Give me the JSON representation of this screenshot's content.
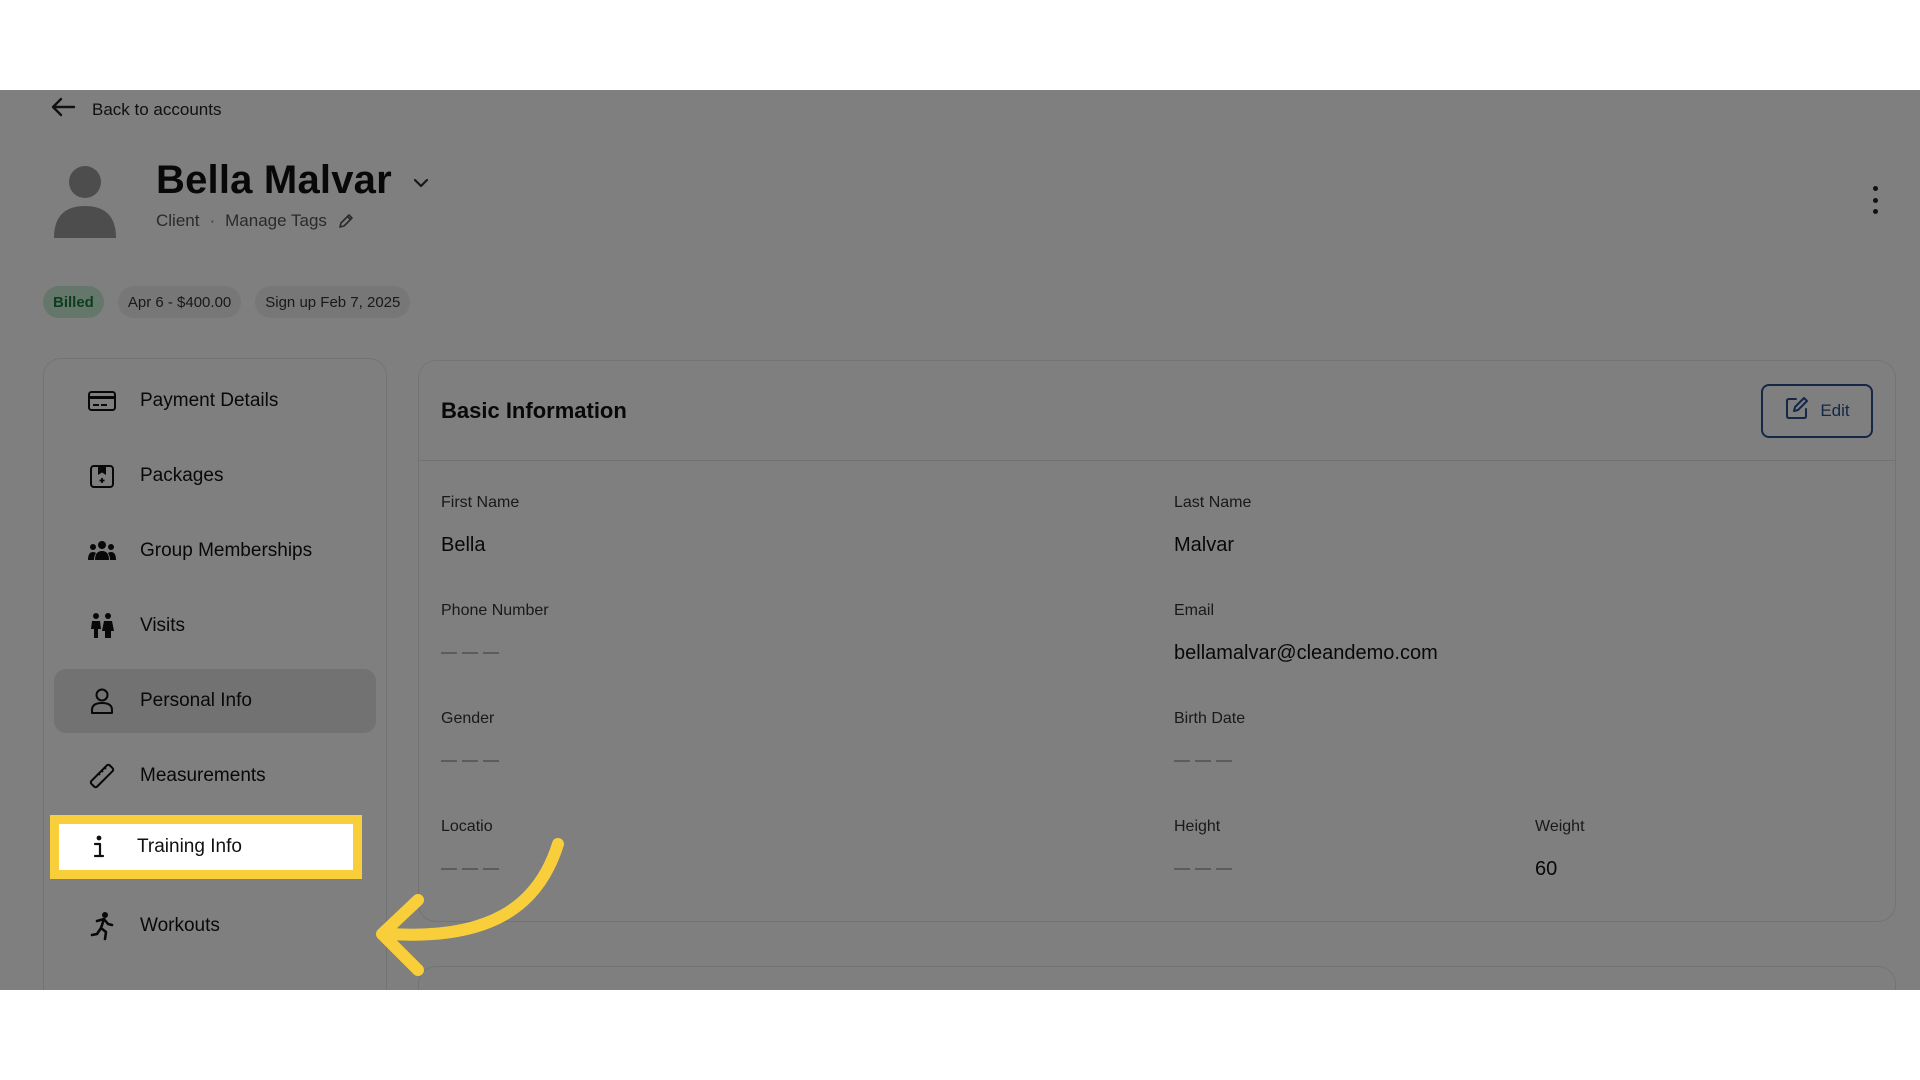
{
  "nav": {
    "back_label": "Back to accounts"
  },
  "profile": {
    "name": "Bella Malvar",
    "role": "Client",
    "separator": "·",
    "manage_tags": "Manage Tags"
  },
  "badges": {
    "billed": "Billed",
    "payment": "Apr 6 - $400.00",
    "signup": "Sign up Feb 7, 2025"
  },
  "sidebar": {
    "items": [
      {
        "label": "Payment Details",
        "icon": "credit-card-icon"
      },
      {
        "label": "Packages",
        "icon": "package-icon"
      },
      {
        "label": "Group Memberships",
        "icon": "group-icon"
      },
      {
        "label": "Visits",
        "icon": "visits-icon"
      },
      {
        "label": "Personal Info",
        "icon": "user-icon",
        "active": true
      },
      {
        "label": "Measurements",
        "icon": "ruler-icon"
      },
      {
        "label": "Training Info",
        "icon": "info-icon",
        "highlighted": true
      },
      {
        "label": "Workouts",
        "icon": "running-icon"
      }
    ]
  },
  "basic_info": {
    "title": "Basic Information",
    "edit_label": "Edit",
    "fields": {
      "first_name": {
        "label": "First Name",
        "value": "Bella"
      },
      "last_name": {
        "label": "Last Name",
        "value": "Malvar"
      },
      "phone": {
        "label": "Phone Number",
        "value": ""
      },
      "email": {
        "label": "Email",
        "value": "bellamalvar@cleandemo.com"
      },
      "gender": {
        "label": "Gender",
        "value": ""
      },
      "birth_date": {
        "label": "Birth Date",
        "value": ""
      },
      "location": {
        "label": "Locatio",
        "value": ""
      },
      "height": {
        "label": "Height",
        "value": ""
      },
      "weight": {
        "label": "Weight",
        "value": "60"
      }
    }
  },
  "colors": {
    "highlight": "#f8cf3a",
    "edit_accent": "#2a4f8f",
    "billed_bg": "#c9eed5",
    "billed_text": "#1f7a3f"
  }
}
